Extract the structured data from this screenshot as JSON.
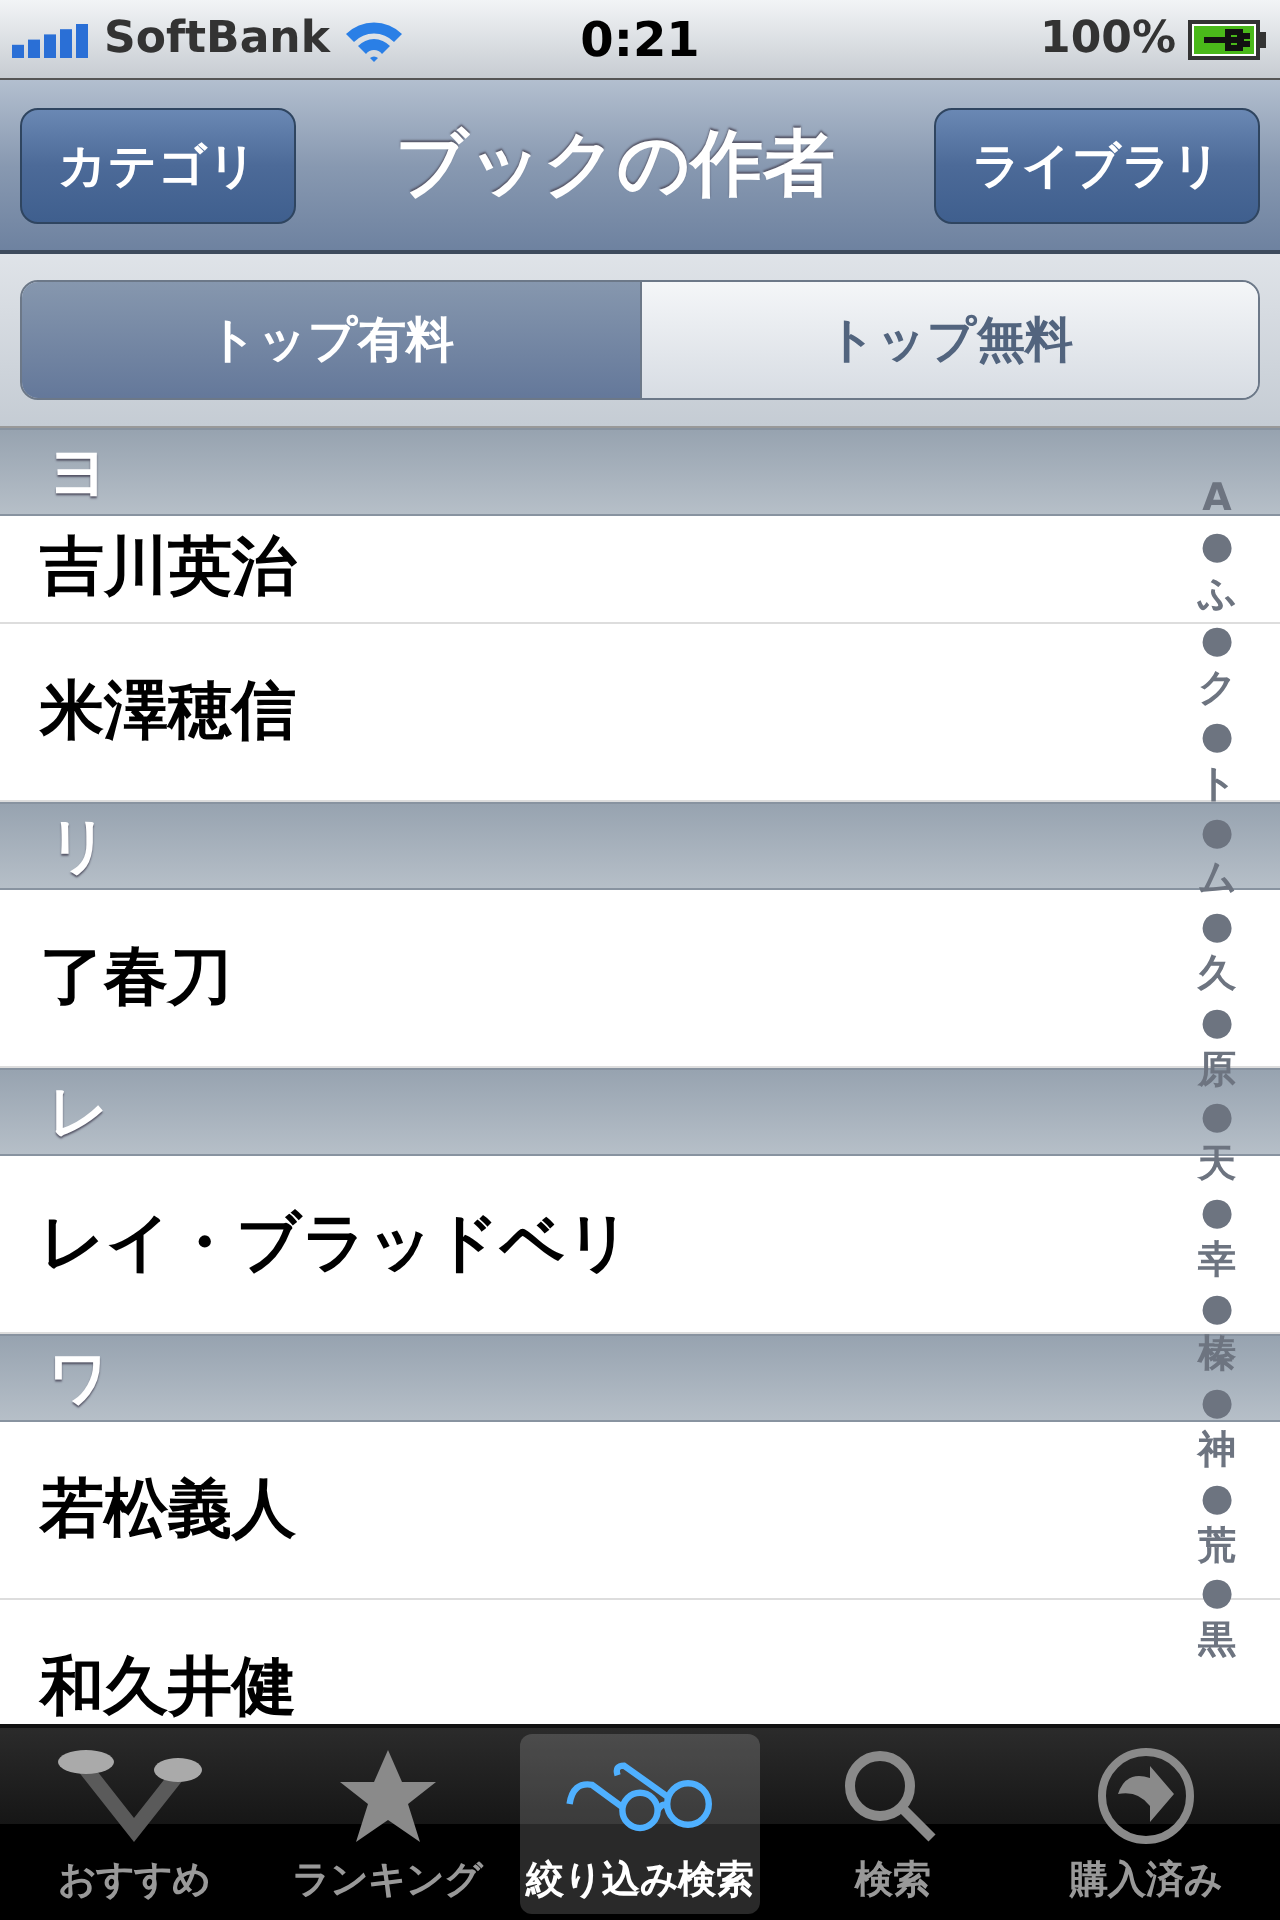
{
  "status_bar": {
    "carrier": "SoftBank",
    "time": "0:21",
    "battery": "100%"
  },
  "nav": {
    "left_button": "カテゴリ",
    "title": "ブックの作者",
    "right_button": "ライブラリ"
  },
  "segments": [
    {
      "label": "トップ有料",
      "selected": true
    },
    {
      "label": "トップ無料",
      "selected": false
    }
  ],
  "sections": [
    {
      "header": "ヨ",
      "rows": [
        "吉川英治",
        "米澤穂信"
      ]
    },
    {
      "header": "リ",
      "rows": [
        "了春刀"
      ]
    },
    {
      "header": "レ",
      "rows": [
        "レイ・ブラッドベリ"
      ]
    },
    {
      "header": "ワ",
      "rows": [
        "若松義人",
        "和久井健"
      ]
    }
  ],
  "index": [
    "A",
    "●",
    "ふ",
    "●",
    "ク",
    "●",
    "ト",
    "●",
    "ム",
    "●",
    "久",
    "●",
    "原",
    "●",
    "天",
    "●",
    "幸",
    "●",
    "榛",
    "●",
    "神",
    "●",
    "荒",
    "●",
    "黒"
  ],
  "tab_bar": [
    {
      "kind": "featured",
      "label": "おすすめ",
      "selected": false
    },
    {
      "kind": "star",
      "label": "ランキング",
      "selected": false
    },
    {
      "kind": "glasses",
      "label": "絞り込み検索",
      "selected": true
    },
    {
      "kind": "search",
      "label": "検索",
      "selected": false
    },
    {
      "kind": "download",
      "label": "購入済み",
      "selected": false
    }
  ]
}
